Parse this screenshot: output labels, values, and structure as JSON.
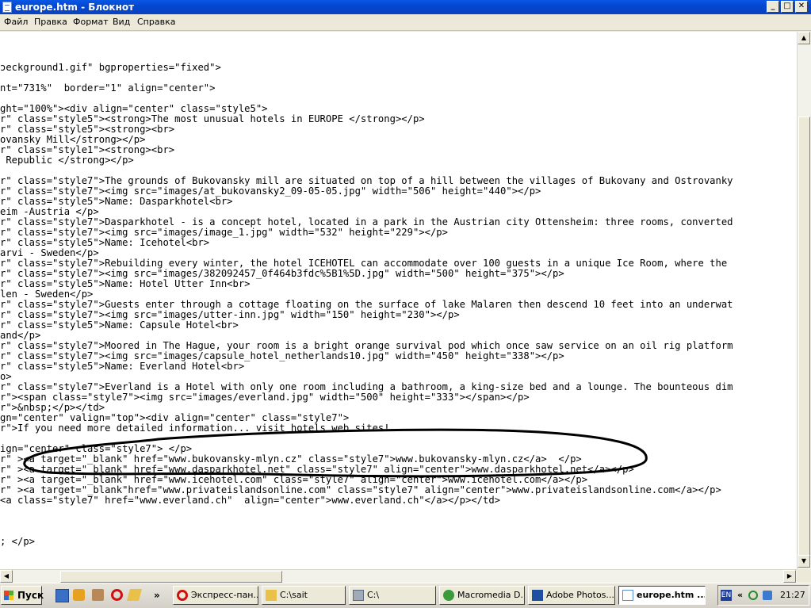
{
  "window": {
    "title": "europe.htm - Блокнот",
    "controls": [
      "_",
      "□",
      "✕"
    ]
  },
  "menu": [
    "Файл",
    "Правка",
    "Формат",
    "Вид",
    "Справка"
  ],
  "editor": {
    "lines": [
      "",
      "",
      "",
      "ɔeckground1.gif\" bgproperties=\"fixed\">",
      "",
      "nt=\"731%\"  border=\"1\" align=\"center\">",
      "",
      "ght=\"100%\"><div align=\"center\" class=\"style5\">",
      "r\" class=\"style5\"><strong>The most unusual hotels in EUROPE </strong></p>",
      "r\" class=\"style5\"><strong><br>",
      "ovansky Mill</strong></p>",
      "r\" class=\"style1\"><strong><br>",
      " Republic </strong></p>",
      "",
      "r\" class=\"style7\">The grounds of Bukovansky mill are situated on top of a hill between the villages of Bukovany and Ostrovanky",
      "r\" class=\"style7\"><img src=\"images/at_bukovansky2_09-05-05.jpg\" width=\"506\" height=\"440\"></p>",
      "r\" class=\"style5\">Name: Dasparkhotel<br>",
      "eim -Austria </p>",
      "r\" class=\"style7\">Dasparkhotel - is a concept hotel, located in a park in the Austrian city Ottensheim: three rooms, converted",
      "r\" class=\"style7\"><img src=\"images/image_1.jpg\" width=\"532\" height=\"229\"></p>",
      "r\" class=\"style5\">Name: Icehotel<br>",
      "arvi - Sweden</p>",
      "r\" class=\"style7\">Rebuilding every winter, the hotel ICEHOTEL can accommodate over 100 guests in a unique Ice Room, where the",
      "r\" class=\"style7\"><img src=\"images/382092457_0f464b3fdc%5B1%5D.jpg\" width=\"500\" height=\"375\"></p>",
      "r\" class=\"style5\">Name: Hotel Utter Inn<br>",
      "len - Sweden</p>",
      "r\" class=\"style7\">Guests enter through a cottage floating on the surface of lake Malaren then descend 10 feet into an underwat",
      "r\" class=\"style7\"><img src=\"images/utter-inn.jpg\" width=\"150\" height=\"230\"></p>",
      "r\" class=\"style5\">Name: Capsule Hotel<br>",
      "and</p>",
      "r\" class=\"style7\">Moored in The Hague, your room is a bright orange survival pod which once saw service on an oil rig platform",
      "r\" class=\"style7\"><img src=\"images/capsule_hotel_netherlands10.jpg\" width=\"450\" height=\"338\"></p>",
      "r\" class=\"style5\">Name: Everland Hotel<br>",
      "o>",
      "r\" class=\"style7\">Everland is a Hotel with only one room including a bathroom, a king-size bed and a lounge. The bounteous dim",
      "r\"><span class=\"style7\"><img src=\"images/everland.jpg\" width=\"500\" height=\"333\"></span></p>",
      "r\">&nbsp;</p></td>",
      "gn=\"center\" valign=\"top\"><div align=\"center\" class=\"style7\">",
      "r\">If you need more detailed information... visit hotels web sites!",
      "",
      "ign=\"center\" class=\"style7\"> </p>",
      "r\" ><a target=\"_blank\" href=\"www.bukovansky-mlyn.cz\" class=\"style7\">www.bukovansky-mlyn.cz</a>  </p>",
      "r\" ><a target=\"_blank\" href=\"www.dasparkhotel.net\" class=\"style7\" align=\"center\">www.dasparkhotel.net</a></p>",
      "r\" ><a target=\"_blank\" href=\"www.icehotel.com\" class=\"style7\" align=\"center\">www.icehotel.com</a></p>",
      "r\" ><a target=\"_blank\"href=\"www.privateislandsonline.com\" class=\"style7\" align=\"center\">www.privateislandsonline.com</a></p>",
      "<a class=\"style7\" href=\"www.everland.ch\"  align=\"center\">www.everland.ch\"</a></p></td>",
      "",
      "",
      "",
      "; </p>"
    ]
  },
  "taskbar": {
    "start_label": "Пуск",
    "quick_launch_more": "»",
    "tasks": [
      {
        "label": "Экспресс-пан...",
        "icon": "opera-icon",
        "color": "#d01010"
      },
      {
        "label": "C:\\sait",
        "icon": "folder-icon",
        "color": "#e8c04a"
      },
      {
        "label": "C:\\",
        "icon": "drive-icon",
        "color": "#7a8aa0"
      },
      {
        "label": "Macromedia D...",
        "icon": "dreamweaver-icon",
        "color": "#3b9a3b"
      },
      {
        "label": "Adobe Photos...",
        "icon": "photoshop-icon",
        "color": "#1f4fa0"
      },
      {
        "label": "europe.htm ...",
        "icon": "notepad-icon",
        "color": "#5a8fd8"
      }
    ],
    "tray": {
      "lang": "EN",
      "chevron": "«",
      "time": "21:27"
    }
  }
}
